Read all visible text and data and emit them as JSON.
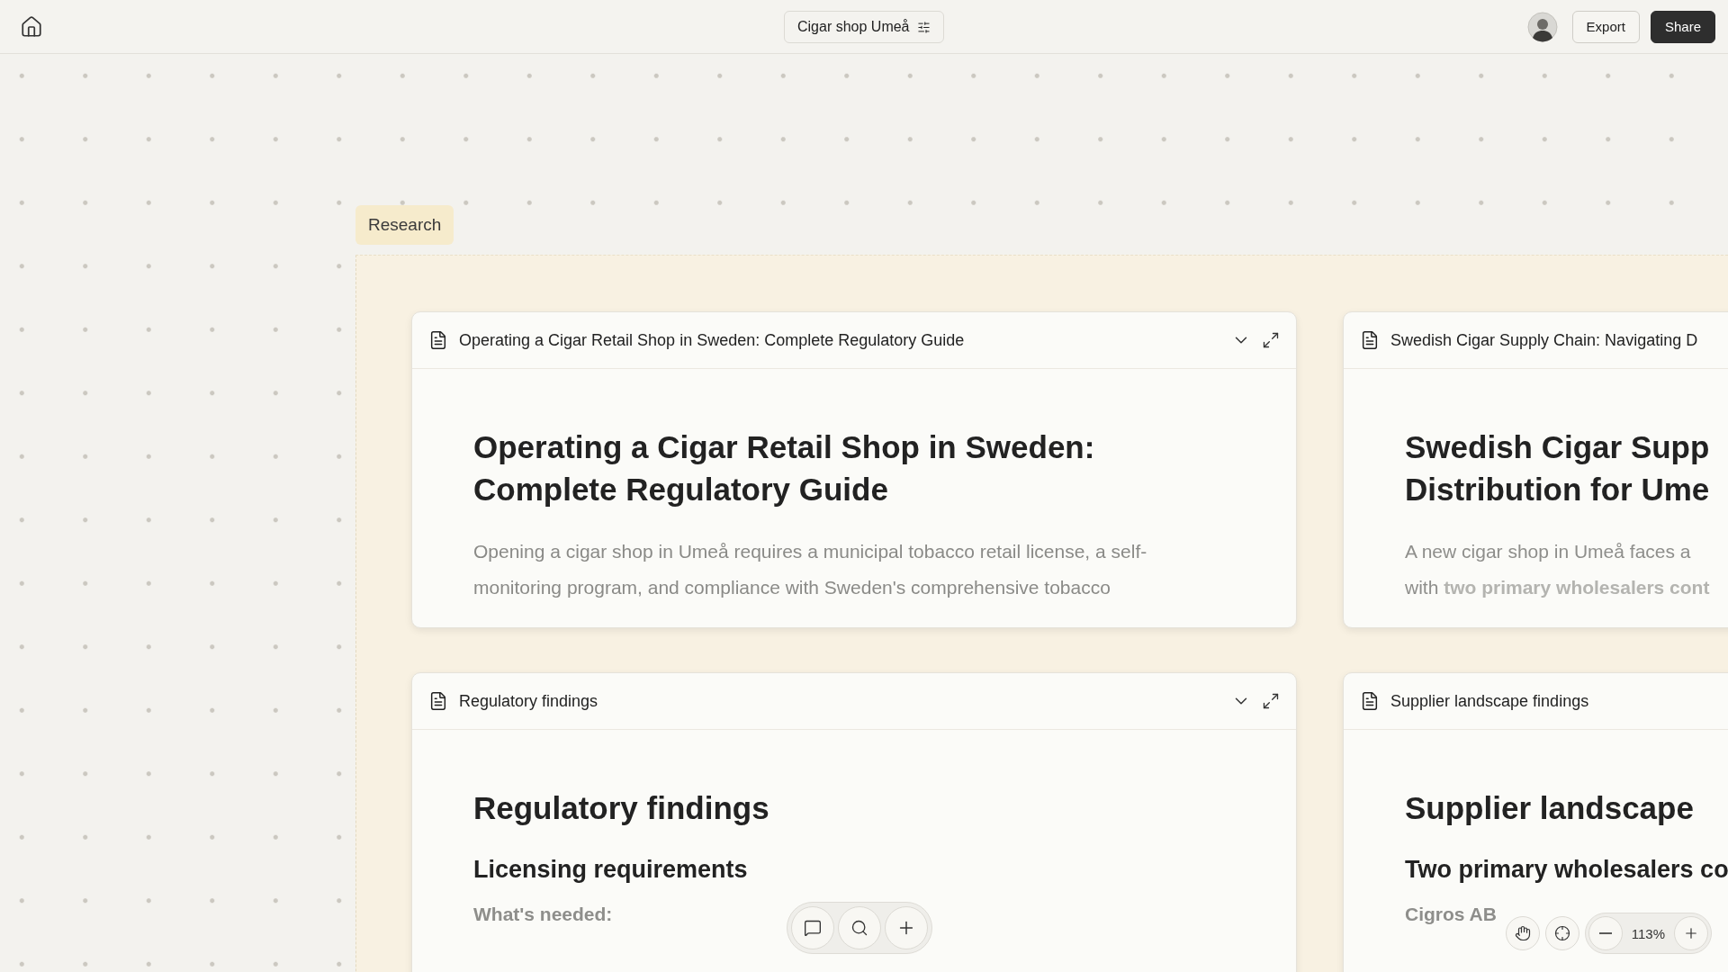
{
  "topbar": {
    "project_title": "Cigar shop Umeå",
    "buttons": [
      {
        "label": "Export",
        "kind": "secondary"
      },
      {
        "label": "Share",
        "kind": "primary"
      }
    ]
  },
  "group": {
    "label": "Research",
    "cards": [
      {
        "title": "Operating a Cigar Retail Shop in Sweden: Complete Regulatory Guide",
        "controls": true,
        "blocks": [
          {
            "kind": "h1",
            "text": "Operating a Cigar Retail Shop in Sweden:"
          },
          {
            "kind": "h1",
            "text": "Complete Regulatory Guide"
          },
          {
            "kind": "p",
            "text": "Opening a cigar shop in Umeå requires a municipal tobacco retail license, a self-monitoring program, and compliance with Sweden's comprehensive tobacco"
          }
        ]
      },
      {
        "title": "Swedish Cigar Supply Chain: Navigating D",
        "blocks": [
          {
            "kind": "h1",
            "text": "Swedish Cigar Supp"
          },
          {
            "kind": "h1",
            "text": "Distribution for Ume"
          },
          {
            "kind": "line",
            "text": "A new cigar shop in Umeå faces a"
          },
          {
            "kind": "line",
            "text": "with **two primary wholesalers cont**"
          }
        ]
      },
      {
        "title": "Regulatory findings",
        "controls": true,
        "blocks": [
          {
            "kind": "h1",
            "text": "Regulatory findings"
          },
          {
            "kind": "h2",
            "text": "Licensing requirements"
          },
          {
            "kind": "label",
            "text": "What's needed:"
          }
        ]
      },
      {
        "title": "Supplier landscape findings",
        "blocks": [
          {
            "kind": "h1",
            "text": "Supplier landscape"
          },
          {
            "kind": "h2",
            "text": "Two primary wholesalers co"
          },
          {
            "kind": "label",
            "text": "Cigros AB"
          }
        ]
      }
    ]
  },
  "zoom": {
    "value": "113%"
  }
}
